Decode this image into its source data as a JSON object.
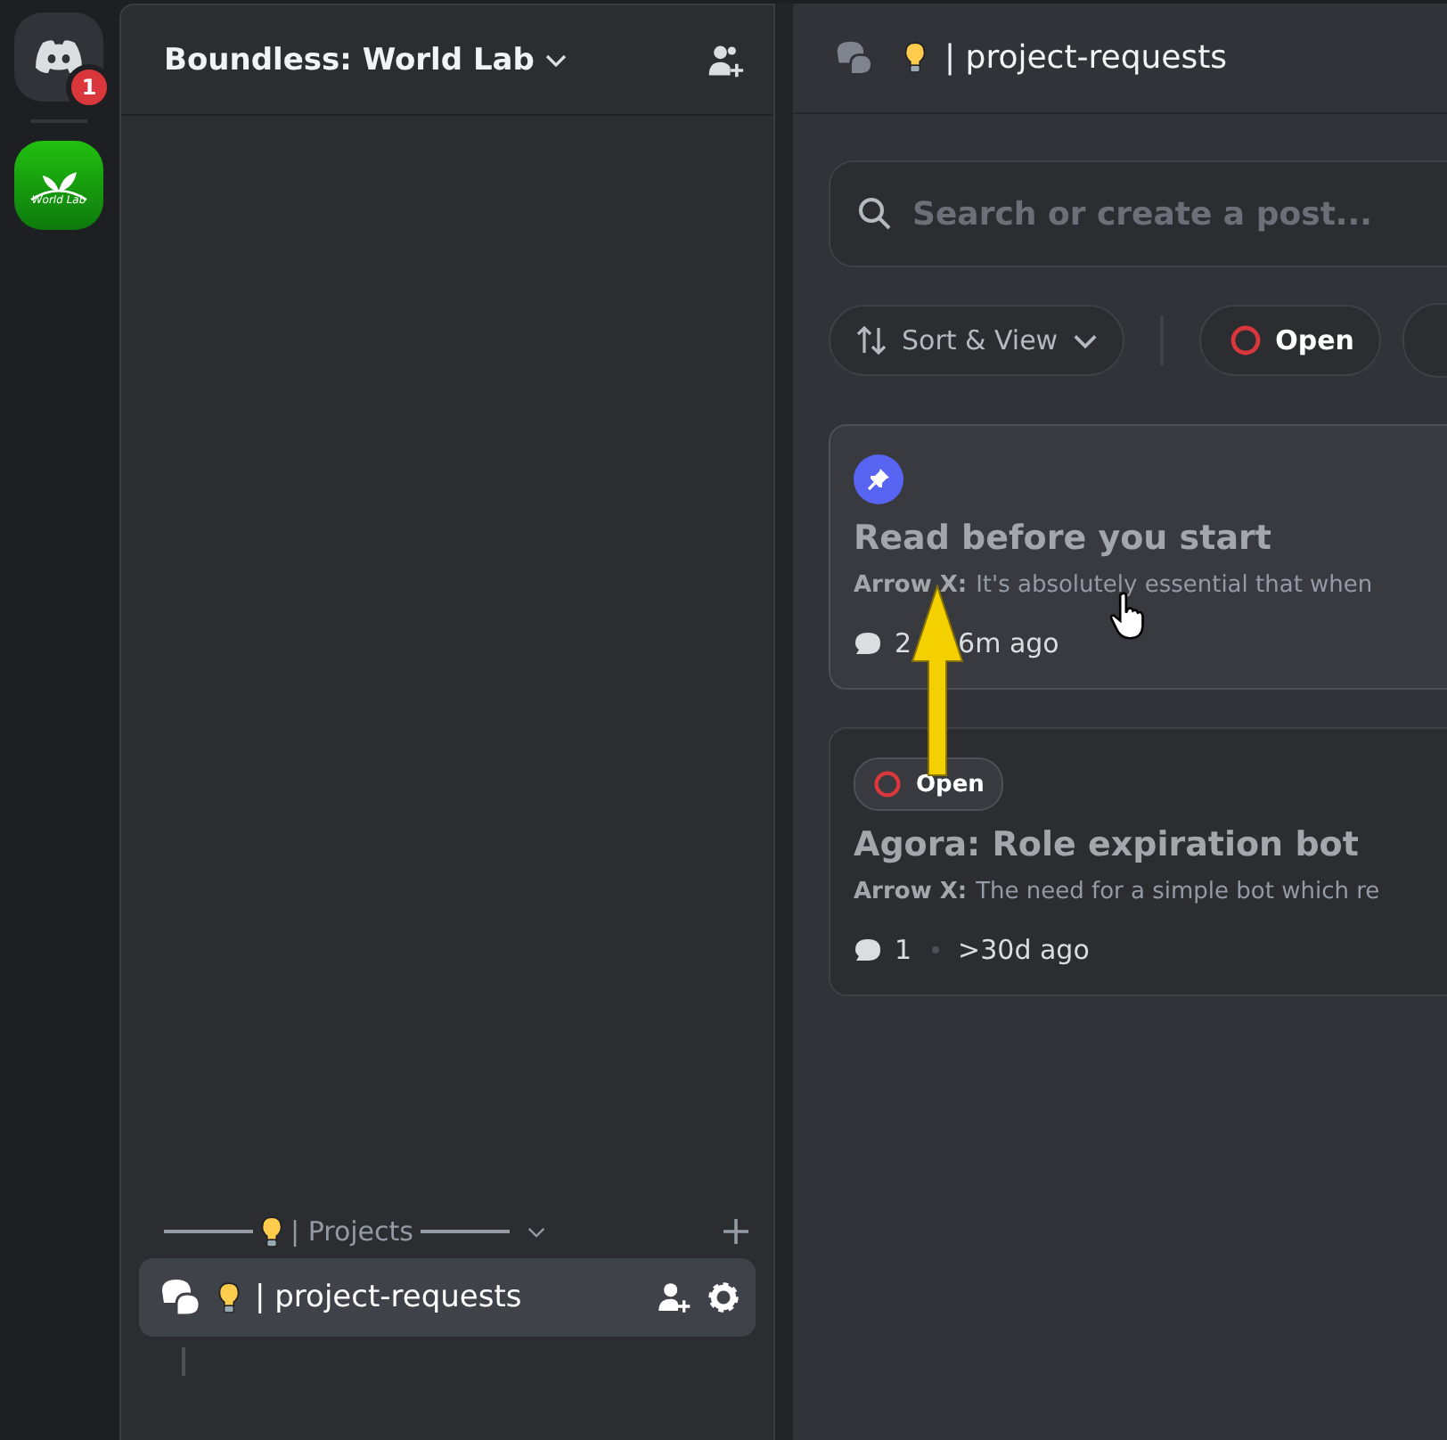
{
  "server_rail": {
    "home_badge": "1",
    "servers": [
      {
        "logo_text": "World Lab"
      }
    ]
  },
  "sidebar": {
    "server_name": "Boundless: World Lab",
    "category": {
      "label": "| Projects",
      "expanded": true
    },
    "channels": [
      {
        "name": "| project-requests",
        "selected": true
      }
    ]
  },
  "channel_header": {
    "title": "| project-requests"
  },
  "search": {
    "placeholder": "Search or create a post..."
  },
  "filters": [
    {
      "kind": "sort",
      "label": "Sort & View"
    },
    {
      "kind": "tag",
      "label": "Open",
      "color": "#da373c"
    }
  ],
  "posts": [
    {
      "pinned": true,
      "title": "Read before you start",
      "author": "Arrow X:",
      "preview": "It's absolutely essential that when",
      "comments": "2",
      "time": "6m ago"
    },
    {
      "pinned": false,
      "tag": {
        "label": "Open",
        "color": "#da373c"
      },
      "title": "Agora: Role expiration bot",
      "author": "Arrow X:",
      "preview": "The need for a simple bot which re",
      "comments": "1",
      "time": ">30d ago"
    }
  ]
}
